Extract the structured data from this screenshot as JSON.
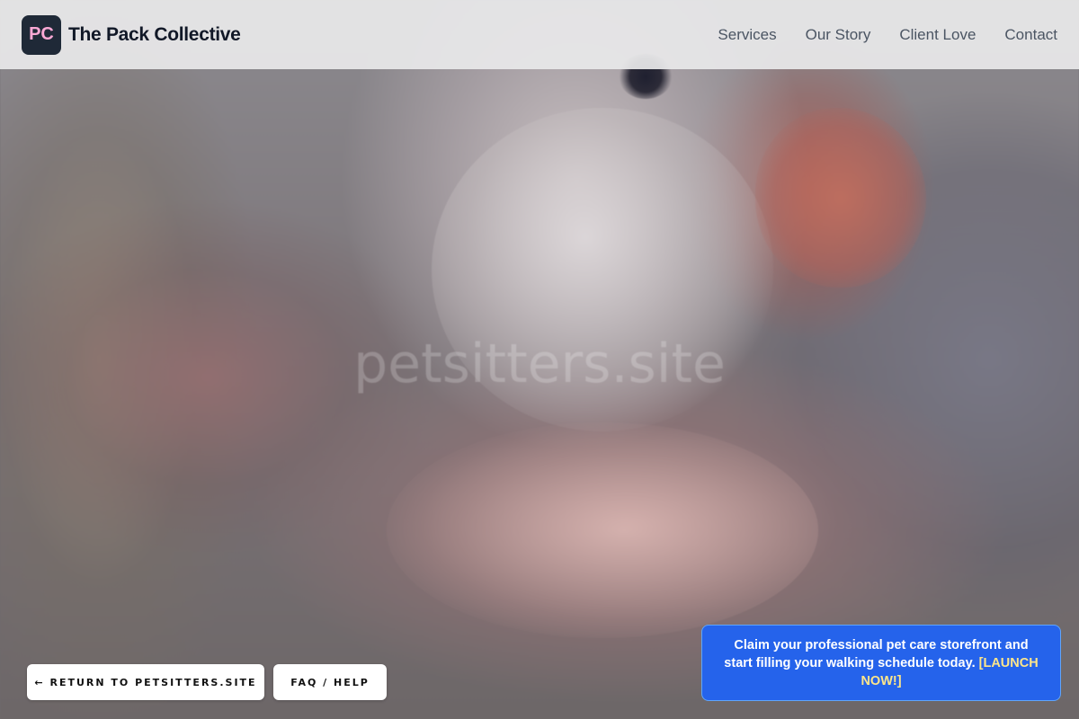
{
  "header": {
    "logo_initials": "PC",
    "brand_name": "The Pack Collective",
    "nav": [
      "Services",
      "Our Story",
      "Client Love",
      "Contact"
    ]
  },
  "hero": {
    "watermark": "petsitters.site"
  },
  "buttons": {
    "return_label": "← RETURN TO PETSITTERS.SITE",
    "faq_label": "FAQ / HELP"
  },
  "cta": {
    "text": "Claim your professional pet care storefront and start filling your walking schedule today.",
    "link": "[LAUNCH NOW!]"
  },
  "colors": {
    "logo_bg": "#1f2937",
    "logo_text": "#f9a8d4",
    "cta_bg": "#2563eb",
    "cta_link": "#fde68a"
  }
}
